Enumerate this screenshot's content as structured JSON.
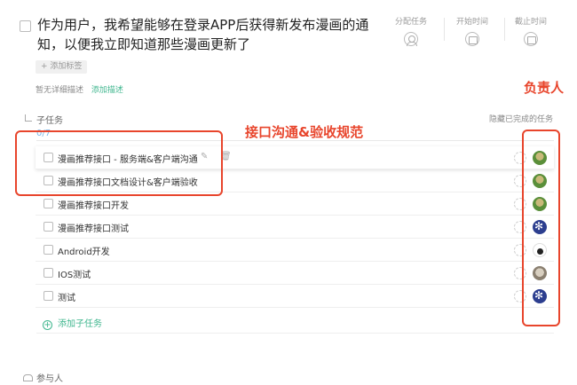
{
  "task": {
    "title": "作为用户，我希望能够在登录APP后获得新发布漫画的通知，以便我立即知道那些漫画更新了",
    "add_tag_label": "+ 添加标签",
    "desc_empty": "暂无详细描述",
    "desc_add": "添加描述"
  },
  "meta": {
    "assign_label": "分配任务",
    "start_label": "开始时间",
    "due_label": "截止时间"
  },
  "subtasks": {
    "title": "子任务",
    "hide_done_label": "隐藏已完成的任务",
    "progress": "0/7",
    "items": [
      {
        "name": "漫画推荐接口 - 服务端&客户端沟通",
        "avatar": "green"
      },
      {
        "name": "漫画推荐接口文档设计&客户端验收",
        "avatar": "green"
      },
      {
        "name": "漫画推荐接口开发",
        "avatar": "green"
      },
      {
        "name": "漫画推荐接口测试",
        "avatar": "blue"
      },
      {
        "name": "Android开发",
        "avatar": "mickey"
      },
      {
        "name": "IOS测试",
        "avatar": "gray"
      },
      {
        "name": "测试",
        "avatar": "blue"
      }
    ],
    "add_label": "添加子任务"
  },
  "participants": {
    "label": "参与人"
  },
  "annotations": {
    "interface_note": "接口沟通&验收规范",
    "owner_note": "负责人"
  },
  "colors": {
    "accent": "#3fb68e",
    "annotation": "#e8452c"
  }
}
